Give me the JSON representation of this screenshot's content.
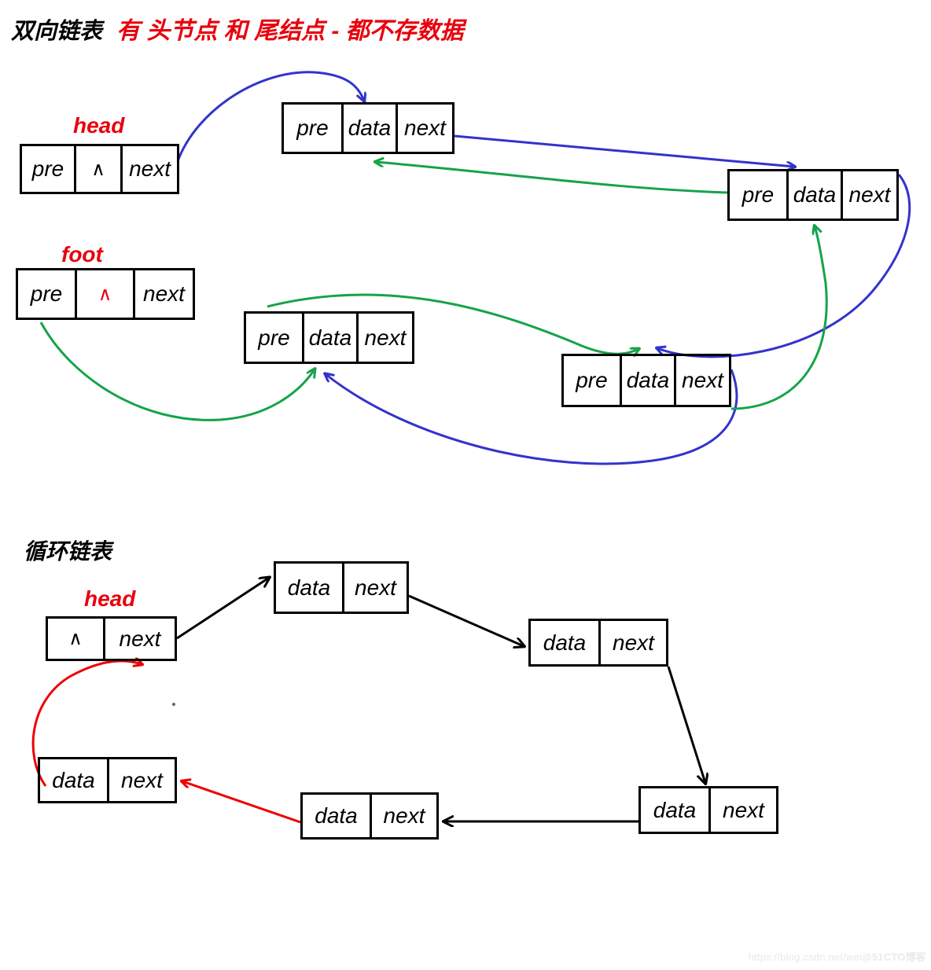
{
  "titles": {
    "main": "双向链表",
    "sub": "有 头节点 和 尾结点 - 都不存数据",
    "section2": "循环链表"
  },
  "colors": {
    "next_pointer": "#3333cc",
    "pre_pointer": "#16a34a",
    "circular_wrap": "#ee0000",
    "node_border": "#000000",
    "label_red": "#e8000d",
    "text": "#000000"
  },
  "doubly_linked_list": {
    "pointer_labels": {
      "head": "head",
      "foot": "foot"
    },
    "cell_text": {
      "pre": "pre",
      "data": "data",
      "next": "next",
      "null": "∧"
    },
    "nodes": [
      {
        "id": "head-node",
        "role": "head-sentinel",
        "cells": [
          "pre",
          "∧",
          "next"
        ]
      },
      {
        "id": "node-1",
        "role": "data-node",
        "cells": [
          "pre",
          "data",
          "next"
        ]
      },
      {
        "id": "node-2",
        "role": "data-node",
        "cells": [
          "pre",
          "data",
          "next"
        ]
      },
      {
        "id": "foot-node",
        "role": "foot-sentinel",
        "cells": [
          "pre",
          "∧",
          "next"
        ]
      },
      {
        "id": "node-4",
        "role": "data-node",
        "cells": [
          "pre",
          "data",
          "next"
        ]
      },
      {
        "id": "node-3",
        "role": "data-node",
        "cells": [
          "pre",
          "data",
          "next"
        ]
      }
    ]
  },
  "circular_linked_list": {
    "pointer_labels": {
      "head": "head"
    },
    "cell_text": {
      "data": "data",
      "next": "next",
      "null": "∧"
    },
    "nodes": [
      {
        "id": "c-head",
        "role": "head-sentinel",
        "cells": [
          "∧",
          "next"
        ]
      },
      {
        "id": "c-node-1",
        "role": "data-node",
        "cells": [
          "data",
          "next"
        ]
      },
      {
        "id": "c-node-2",
        "role": "data-node",
        "cells": [
          "data",
          "next"
        ]
      },
      {
        "id": "c-node-3",
        "role": "data-node",
        "cells": [
          "data",
          "next"
        ]
      },
      {
        "id": "c-node-4",
        "role": "data-node",
        "cells": [
          "data",
          "next"
        ]
      },
      {
        "id": "c-node-5",
        "role": "data-node",
        "cells": [
          "data",
          "next"
        ]
      }
    ]
  },
  "watermark": {
    "url": "https://blog.csdn.net/wei",
    "brand": "@51CTO博客"
  }
}
